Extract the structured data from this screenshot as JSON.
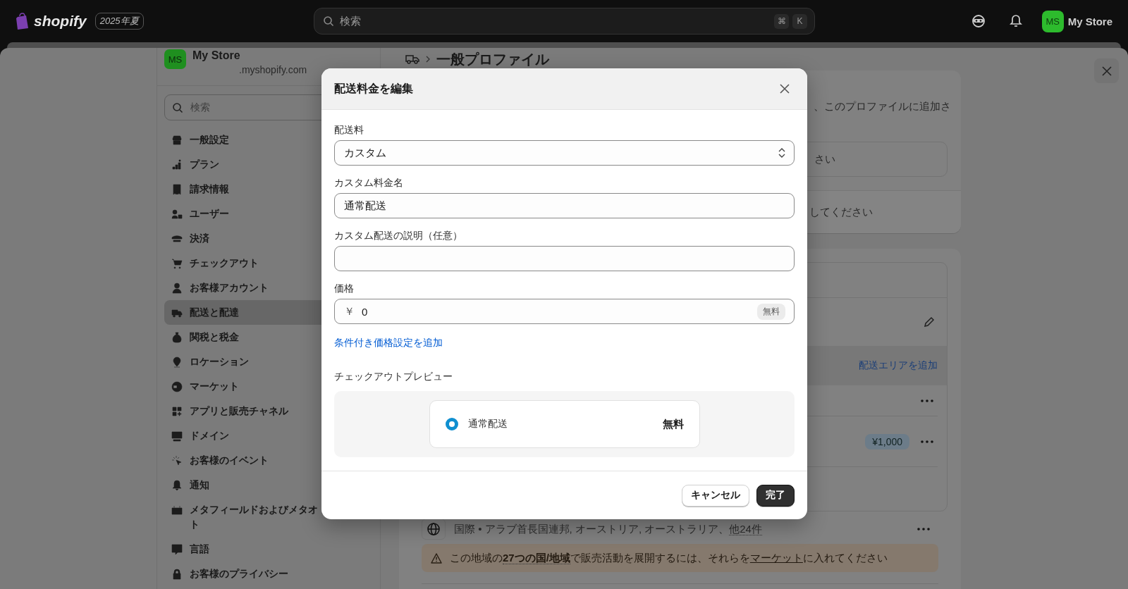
{
  "top_bar": {
    "logo": "shopify",
    "edition_badge": "2025年夏",
    "search": {
      "placeholder": "検索",
      "shortcut_keys": [
        "⌘",
        "K"
      ]
    },
    "account": {
      "initials": "MS",
      "name": "My Store"
    }
  },
  "sidebar": {
    "store": {
      "initials": "MS",
      "name": "My Store",
      "domain": ".myshopify.com"
    },
    "search": {
      "placeholder": "検索"
    },
    "items": [
      {
        "label": "一般設定",
        "selected": false
      },
      {
        "label": "プラン",
        "selected": false
      },
      {
        "label": "請求情報",
        "selected": false
      },
      {
        "label": "ユーザー",
        "selected": false
      },
      {
        "label": "決済",
        "selected": false
      },
      {
        "label": "チェックアウト",
        "selected": false
      },
      {
        "label": "お客様アカウント",
        "selected": false
      },
      {
        "label": "配送と配達",
        "selected": true
      },
      {
        "label": "関税と税金",
        "selected": false
      },
      {
        "label": "ロケーション",
        "selected": false
      },
      {
        "label": "マーケット",
        "selected": false
      },
      {
        "label": "アプリと販売チャネル",
        "selected": false
      },
      {
        "label": "ドメイン",
        "selected": false
      },
      {
        "label": "お客様のイベント",
        "selected": false
      },
      {
        "label": "通知",
        "selected": false
      },
      {
        "label": "メタフィールドおよびメタオ",
        "continued": "ト",
        "selected": false
      },
      {
        "label": "言語",
        "selected": false
      },
      {
        "label": "お客様のプライバシー",
        "selected": false
      }
    ]
  },
  "page": {
    "breadcrumb_title": "一般プロファイル",
    "card_1": {
      "text_fragment": "、このプロファイルに追加さ",
      "field_fragment": "さい",
      "footer_fragment": "してください"
    },
    "zones": {
      "add_link": "配送エリアを追加",
      "rate_rows": [
        {
          "kind": "plain"
        },
        {
          "kind": "priced",
          "price": "¥1,000"
        }
      ],
      "international": {
        "summary": "国際 • アラブ首長国連邦, オーストリア, オーストラリア、",
        "more": "他24件"
      },
      "warning": {
        "before": "この地域の",
        "highlight": "27つの国/地域",
        "middle": "で販売活動を展開するには、それらを",
        "link": "マーケット",
        "after": "に入れてください"
      }
    }
  },
  "modal": {
    "title": "配送料金を編集",
    "fields": [
      {
        "kind": "select",
        "label": "配送料",
        "value": "カスタム"
      },
      {
        "kind": "text",
        "label": "カスタム料金名",
        "value": "通常配送"
      },
      {
        "kind": "text",
        "label": "カスタム配送の説明（任意）"
      },
      {
        "kind": "price",
        "label": "価格",
        "prefix": "￥",
        "value": "0",
        "badge": "無料"
      }
    ],
    "add_condition_link": "条件付き価格設定を追加",
    "preview": {
      "label": "チェックアウトプレビュー",
      "option": {
        "name": "通常配送",
        "price": "無料",
        "selected": true
      }
    },
    "buttons": [
      {
        "label": "キャンセル",
        "kind": "secondary"
      },
      {
        "label": "完了",
        "kind": "primary"
      }
    ]
  }
}
